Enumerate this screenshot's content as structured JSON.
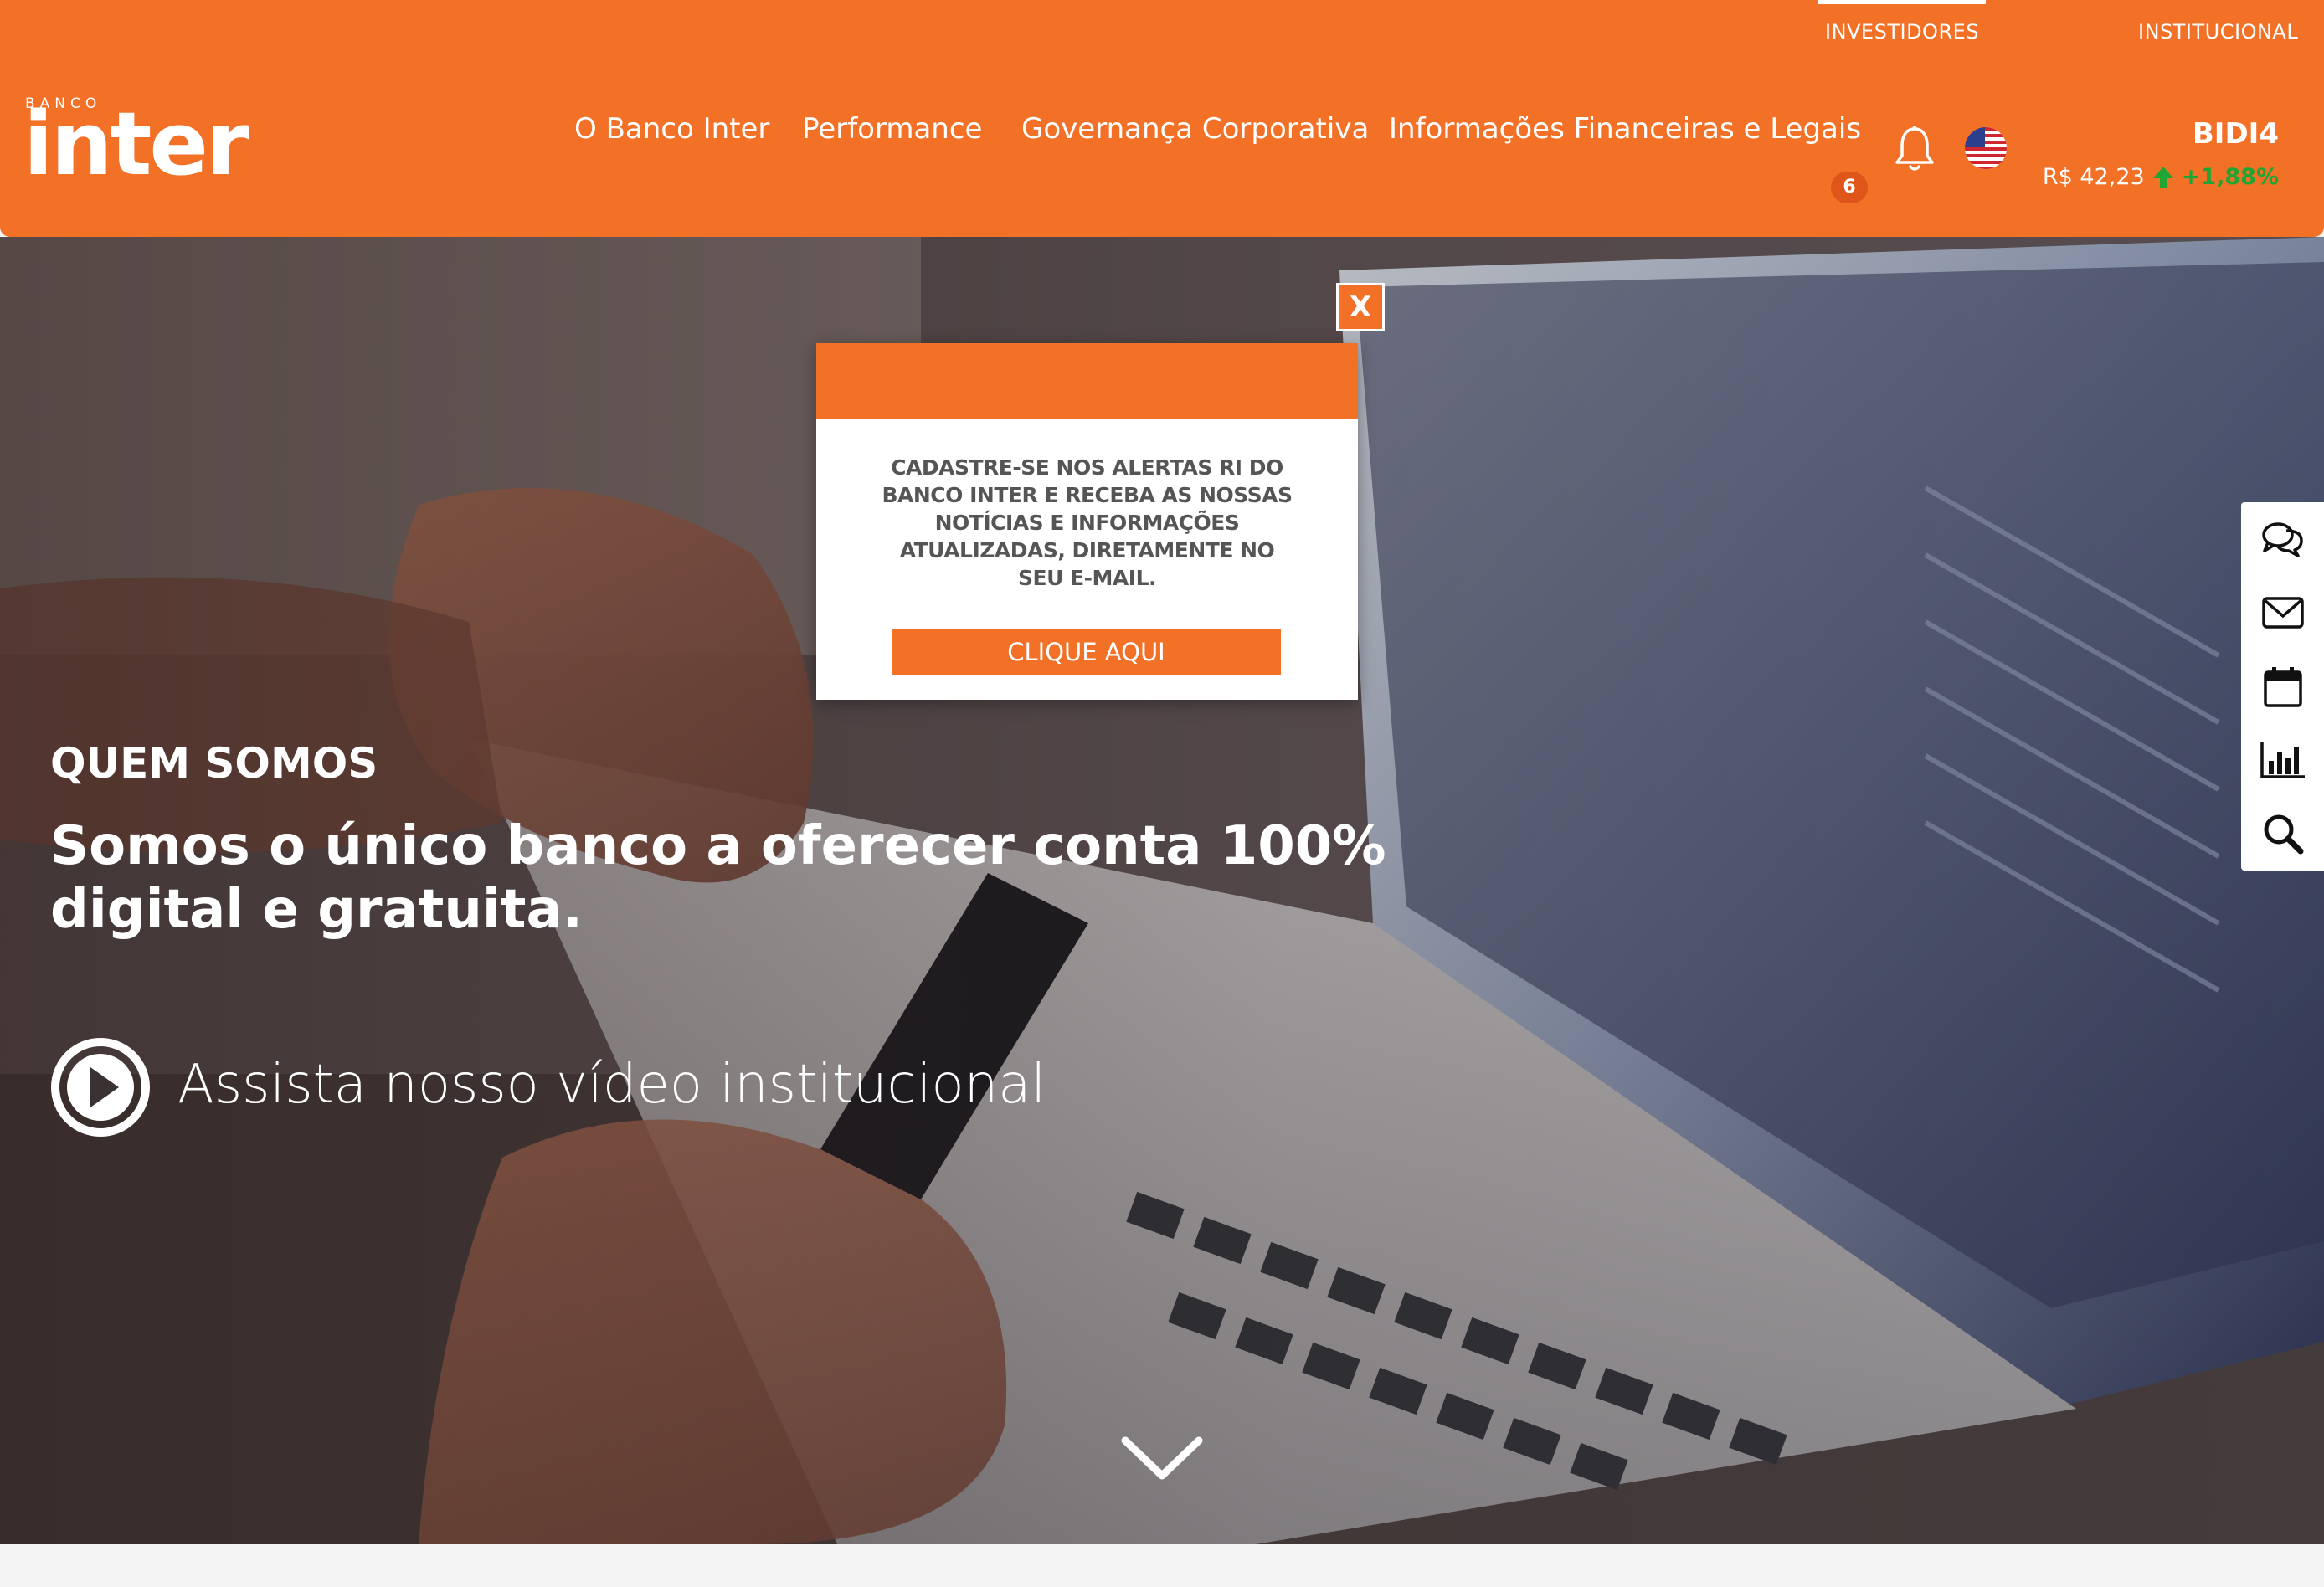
{
  "header": {
    "top_links": [
      "INVESTIDORES",
      "INSTITUCIONAL"
    ],
    "logo_small": "BANCO",
    "logo_big": "inter",
    "nav": [
      "O Banco Inter",
      "Performance",
      "Governança Corporativa",
      "Informações Financeiras e Legais"
    ],
    "notifications_count": "6",
    "ticker": {
      "symbol": "BIDI4",
      "price": "R$ 42,23",
      "change": "+1,88%"
    }
  },
  "hero": {
    "kicker": "QUEM SOMOS",
    "title": "Somos o único banco a oferecer conta 100% digital e gratuita.",
    "video_link": "Assista nosso vídeo institucional"
  },
  "popup": {
    "close_label": "X",
    "message": "CADASTRE-SE NOS ALERTAS RI DO BANCO INTER E RECEBA AS NOSSAS NOTÍCIAS E INFORMAÇÕES ATUALIZADAS, DIRETAMENTE NO SEU E-MAIL.",
    "cta": "CLIQUE AQUI"
  },
  "sidebar": {
    "icons": [
      "chat-icon",
      "mail-icon",
      "calendar-icon",
      "bar-chart-icon",
      "search-icon"
    ]
  },
  "colors": {
    "brand_orange": "#f37027",
    "positive_green": "#1fa533"
  }
}
